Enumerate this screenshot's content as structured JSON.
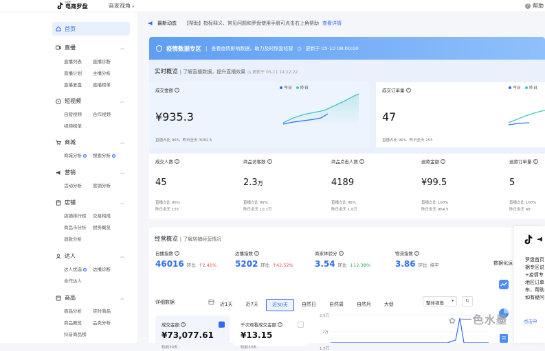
{
  "topbar": {
    "logo_small": "抖音",
    "logo_text": "电商罗盘",
    "role": "商家视角",
    "help": "帮助"
  },
  "sidebar": {
    "home": "首页",
    "sections": [
      {
        "label": "直播",
        "items": [
          "直播列表",
          "直播诊断",
          "直播计划",
          "主播分析",
          "直播复盘",
          "直播榜单"
        ]
      },
      {
        "label": "短视频",
        "items": [
          "自营视频",
          "合作视频",
          "视频榜单"
        ]
      },
      {
        "label": "商城",
        "items": [
          "商城分析",
          "搜索分析"
        ]
      },
      {
        "label": "营销",
        "items": [
          "活动分析",
          "营销分析"
        ]
      },
      {
        "label": "店铺",
        "items": [
          "店铺排行榜",
          "交易构成",
          "商品卡分析",
          "财务概览",
          "退款分析"
        ]
      },
      {
        "label": "达人",
        "items": [
          "达人优选",
          "达播诊断",
          "合作达人"
        ]
      },
      {
        "label": "商品",
        "items": [
          "商品分析",
          "实时商品",
          "商品概览",
          "品类分析",
          "抖音商品榜"
        ]
      }
    ]
  },
  "notice": {
    "title": "最新动态",
    "text": "【帮助】指标释义、常见问题和罗盘使用手册可点击右上角帮助",
    "link": "查看详情"
  },
  "banner": {
    "title": "疫情数据专区",
    "text": "查看疫情影响数据，助力及时恢复经营",
    "updated": "更新于 05-10 08:00:00"
  },
  "realtime": {
    "title": "实时概览",
    "subtitle": "了解直播数据，提升直播效果",
    "updated": "更新于 05-11 14:12:22",
    "legend_today": "今日",
    "legend_yesterday": "昨日",
    "gmv": {
      "label": "成交金额",
      "value": "¥935.3",
      "ratio": "直播占比 96%",
      "yesterday": "昨日全天 3082.5"
    },
    "orders": {
      "label": "成交订单量",
      "value": "47",
      "ratio": "直播占比 96%",
      "yesterday": "昨日全天 155"
    },
    "metrics": [
      {
        "label": "成交人数",
        "value": "45",
        "unit": "",
        "ratio": "直播占比 96%",
        "yesterday": "昨日全天 155"
      },
      {
        "label": "商品访客数",
        "value": "2.3",
        "unit": "万",
        "ratio": "直播占比 99%",
        "yesterday": "昨日全天 10.7万"
      },
      {
        "label": "商品点击人数",
        "value": "4189",
        "unit": "",
        "ratio": "直播占比 98%",
        "yesterday": "昨日全天 1.6万"
      },
      {
        "label": "退款金额",
        "value": "¥99.5",
        "unit": "",
        "ratio": "直播占比 100%",
        "yesterday": "昨日全天 964.5"
      },
      {
        "label": "退款订单量",
        "value": "5",
        "unit": "",
        "ratio": "直播占比 100%",
        "yesterday": "昨日全天 48"
      }
    ]
  },
  "operations": {
    "title": "经营概览",
    "subtitle": "了解店铺经营情况",
    "kpis": [
      {
        "label": "自播指数",
        "value": "46016",
        "cmp": "环比",
        "change": "2.41%",
        "dir": "up"
      },
      {
        "label": "达播指数",
        "value": "5202",
        "cmp": "环比",
        "change": "42.52%",
        "dir": "up"
      },
      {
        "label": "商家体验分",
        "value": "3.54",
        "cmp": "环比",
        "change": "12.38%",
        "dir": "down"
      },
      {
        "label": "物流指数",
        "value": "3.86",
        "cmp": "环比",
        "change": "持平",
        "dir": "flat"
      }
    ],
    "side_title": "数据化运",
    "detail_label": "详细数据",
    "tabs": [
      "近1天",
      "近7天",
      "近30天",
      "自然日",
      "自然周",
      "自然月",
      "大促"
    ],
    "active_tab": "近30天",
    "select": "整体视角",
    "mini_cards": [
      {
        "label": "成交金额",
        "value": "¥73,077.61",
        "cmp": "较前30天 -"
      },
      {
        "label": "千次观看成交金额",
        "value": "¥13.15",
        "cmp": "较前30天 -"
      }
    ],
    "y_ticks": [
      "2.5万",
      "2万",
      "1.5万"
    ]
  },
  "popup": {
    "text": "罗盘首页\n据专区说\n+疫情专\n地区订单\n布，帮助\n如有疑问",
    "link": "点击申"
  },
  "watermark": "一色水墨",
  "colors": {
    "accent": "#2e6bf0",
    "today": "#2e6bf0",
    "yesterday": "#3cc8c0",
    "up": "#e5484d",
    "down": "#1fa65a"
  }
}
